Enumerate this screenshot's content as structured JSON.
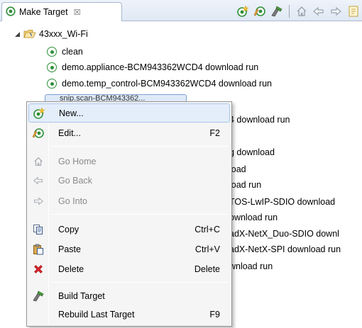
{
  "view_tab": {
    "title": "Make Target",
    "close_glyph": "☒"
  },
  "toolbar": {
    "buttons": [
      "new-target-icon",
      "edit-target-icon",
      "build-target-icon",
      "home-icon",
      "back-arrow-icon",
      "forward-arrow-icon",
      "collapse-icon"
    ]
  },
  "tree": {
    "project": "43xxx_Wi-Fi",
    "items": [
      "clean",
      "demo.appliance-BCM943362WCD4 download run",
      "demo.temp_control-BCM943362WCD4 download run",
      "snip.scan-BCM943362...",
      "4 download run",
      "g download",
      "load",
      "load run",
      "TOS-LwIP-SDIO download",
      "ownload run",
      "adX-NetX_Duo-SDIO downl",
      "adX-NetX-SPI download run",
      "wnload run"
    ]
  },
  "context_menu": {
    "items": [
      {
        "label": "New...",
        "shortcut": "",
        "icon": "new-target-icon",
        "enabled": true
      },
      {
        "label": "Edit...",
        "shortcut": "F2",
        "icon": "edit-target-icon",
        "enabled": true
      },
      {
        "label": "Go Home",
        "shortcut": "",
        "icon": "home-icon",
        "enabled": false
      },
      {
        "label": "Go Back",
        "shortcut": "",
        "icon": "back-arrow-icon",
        "enabled": false
      },
      {
        "label": "Go Into",
        "shortcut": "",
        "icon": "forward-arrow-icon",
        "enabled": false
      },
      {
        "label": "Copy",
        "shortcut": "Ctrl+C",
        "icon": "copy-icon",
        "enabled": true
      },
      {
        "label": "Paste",
        "shortcut": "Ctrl+V",
        "icon": "paste-icon",
        "enabled": true
      },
      {
        "label": "Delete",
        "shortcut": "Delete",
        "icon": "delete-icon",
        "enabled": true
      },
      {
        "label": "Build Target",
        "shortcut": "",
        "icon": "build-target-icon",
        "enabled": true
      },
      {
        "label": "Rebuild Last Target",
        "shortcut": "F9",
        "icon": "rebuild-icon",
        "enabled": true
      }
    ]
  },
  "colors": {
    "target_green": "#2f8f3a",
    "selection_border": "#7da2ce",
    "menu_hover": "#e4eefa"
  }
}
